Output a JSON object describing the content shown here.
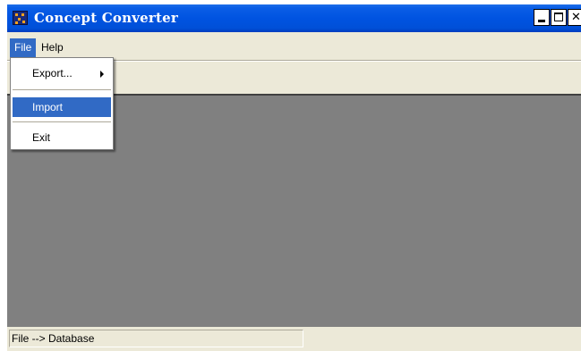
{
  "window": {
    "title": "Concept Converter",
    "icon": "app-icon",
    "controls": {
      "minimize": "minimize-icon",
      "maximize": "maximize-icon",
      "close": "close-icon"
    }
  },
  "menubar": {
    "items": [
      {
        "label": "File",
        "active": true
      },
      {
        "label": "Help",
        "active": false
      }
    ]
  },
  "file_menu": {
    "items": [
      {
        "label": "Export...",
        "has_submenu": true
      },
      {
        "label": "Import",
        "highlighted": true
      },
      {
        "label": "Exit"
      }
    ]
  },
  "statusbar": {
    "text": "File --> Database"
  },
  "colors": {
    "titlebar": "#0053e1",
    "highlight": "#316ac5",
    "content_background": "#808080",
    "chrome": "#ece9d8"
  }
}
